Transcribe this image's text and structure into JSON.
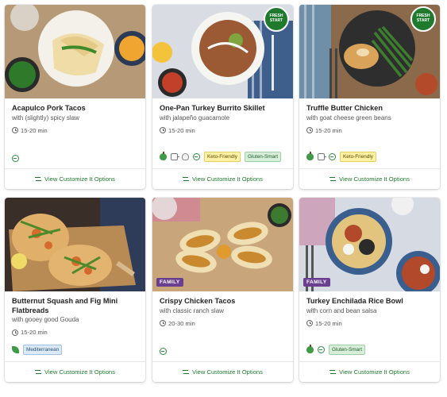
{
  "recipes": [
    {
      "title": "Acapulco Pork Tacos",
      "subtitle": "with (slightly) spicy slaw",
      "time": "15-20 min",
      "tags": [],
      "badge": "",
      "customize_label": "View Customize It Options"
    },
    {
      "title": "One-Pan Turkey Burrito Skillet",
      "subtitle": "with jalapeño guacamole",
      "time": "15-20 min",
      "tags": [
        "Keto-Friendly",
        "Gluten-Smart"
      ],
      "badge": "FRESH START",
      "customize_label": "View Customize It Options"
    },
    {
      "title": "Truffle Butter Chicken",
      "subtitle": "with goat cheese green beans",
      "time": "15-20 min",
      "tags": [
        "Keto-Friendly"
      ],
      "badge": "FRESH START",
      "customize_label": "View Customize It Options"
    },
    {
      "title": "Butternut Squash and Fig Mini Flatbreads",
      "subtitle": "with gooey good Gouda",
      "time": "15-20 min",
      "tags": [
        "Mediterranean"
      ],
      "badge": "",
      "customize_label": "View Customize It Options"
    },
    {
      "title": "Crispy Chicken Tacos",
      "subtitle": "with classic ranch slaw",
      "time": "20-30 min",
      "tags": [],
      "badge": "FAMILY",
      "customize_label": "View Customize It Options"
    },
    {
      "title": "Turkey Enchilada Rice Bowl",
      "subtitle": "with corn and bean salsa",
      "time": "15-20 min",
      "tags": [
        "Gluten-Smart"
      ],
      "badge": "FAMILY",
      "customize_label": "View Customize It Options"
    }
  ],
  "badges": {
    "fresh_line1": "FRESH",
    "fresh_line2": "START"
  },
  "icons": [
    "clock-icon",
    "customize-swap-icon",
    "apple-icon",
    "pan-icon",
    "leaf-icon",
    "garlic-icon"
  ],
  "colors": {
    "accent_green": "#1f7a2e",
    "family_purple": "#6b3f8f",
    "keto_yellow": "#fff1a6",
    "gluten_green": "#d7eed9",
    "med_blue": "#dbe9f6"
  }
}
